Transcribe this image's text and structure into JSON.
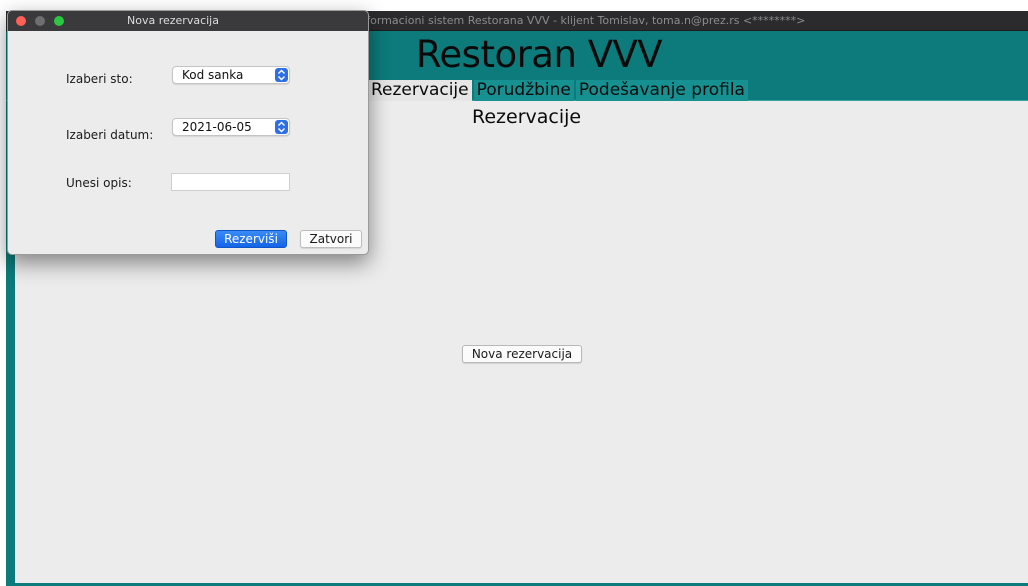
{
  "main_window": {
    "title": "Informacioni sistem Restorana VVV - klijent Tomislav, toma.n@prez.rs <********>",
    "app_title": "Restoran VVV",
    "tabs": [
      {
        "label": "Rezervacije",
        "active": true
      },
      {
        "label": "Porudžbine",
        "active": false
      },
      {
        "label": "Podešavanje profila",
        "active": false
      }
    ],
    "section_title": "Rezervacije",
    "new_reservation_button": "Nova rezervacija"
  },
  "dialog": {
    "title": "Nova rezervacija",
    "table_label": "Izaberi sto:",
    "table_value": "Kod sanka",
    "date_label": "Izaberi datum:",
    "date_value": "2021-06-05",
    "description_label": "Unesi opis:",
    "description_value": "",
    "reserve_button": "Rezerviši",
    "close_button": "Zatvori"
  },
  "colors": {
    "accent_teal": "#0d7b7b",
    "primary_button": "#1464e8"
  }
}
